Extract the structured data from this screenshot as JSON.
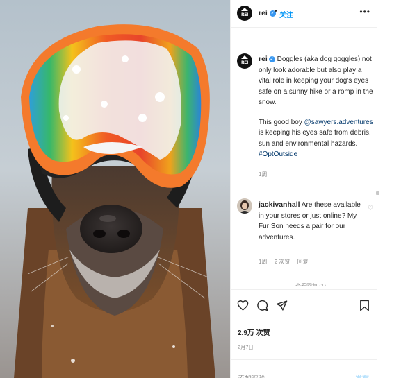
{
  "header": {
    "avatar_text": "REI",
    "username": "rei",
    "verified_icon": "check",
    "separator": "•",
    "follow_label": "关注",
    "more_icon": "•••"
  },
  "caption": {
    "username": "rei",
    "paragraph1": "Doggles (aka dog goggles) not only look adorable but also play a vital role in keeping your dog's eyes safe on a sunny hike or a romp in the snow.",
    "p2_before": "This good boy ",
    "p2_mention": "@sawyers.adventures",
    "p2_after": " is keeping his eyes safe from debris, sun and environmental hazards.",
    "hashtag": "#OptOutside",
    "time": "1周"
  },
  "comment": {
    "username": "jackivanhall",
    "text": " Are these available in your stores or just online? My Fur Son needs a pair for our adventures.",
    "time": "1周",
    "likes": "2 次赞",
    "reply_label": "回复",
    "more_replies": "查看回复 (1)"
  },
  "actions": {
    "likes": "2.9万 次赞",
    "date": "2月7日"
  },
  "add_comment": {
    "placeholder": "添加评论...",
    "post_label": "发布"
  },
  "colors": {
    "accent": "#0095f6",
    "goggle_frame": "#f47a2c",
    "verified": "#3897f0"
  }
}
